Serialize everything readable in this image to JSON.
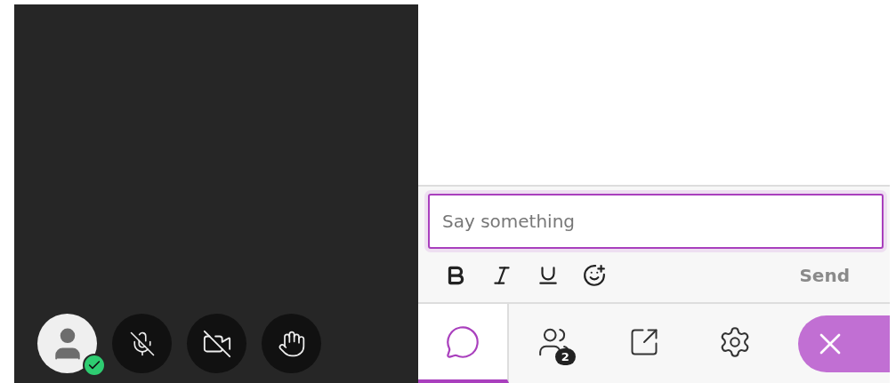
{
  "stage": {
    "controls": [
      {
        "kind": "avatar",
        "color": "#2ecc71"
      },
      {
        "kind": "microphone",
        "off": true
      },
      {
        "kind": "camera",
        "off": true
      },
      {
        "kind": "hand"
      }
    ]
  },
  "chat": {
    "placeholder": "Say something",
    "formatting": [
      {
        "kind": "bold"
      },
      {
        "kind": "italic"
      },
      {
        "kind": "underline"
      },
      {
        "kind": "emoji"
      }
    ],
    "send": "Send",
    "send_disabled": true
  },
  "tabs": [
    {
      "kind": "chat",
      "selected": true
    },
    {
      "kind": "participants",
      "selected": false,
      "badge": "2"
    },
    {
      "kind": "share",
      "selected": false
    },
    {
      "kind": "settings",
      "selected": false
    }
  ]
}
